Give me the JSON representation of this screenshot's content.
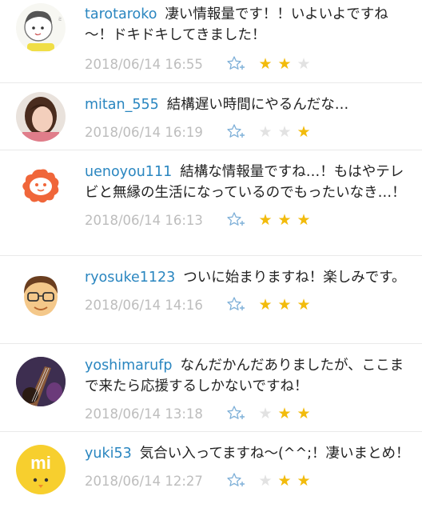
{
  "colors": {
    "username": "#2a86c0",
    "star_on": "#f2bb0c",
    "star_off": "#e2e2e2",
    "date": "#bdbdbd"
  },
  "comments": [
    {
      "user": "tarotaroko",
      "text": "凄い情報量です！！いよいよですね～！ドキドキしてきました！",
      "date": "2018/06/14 16:55",
      "avatar_icon": "cartoon-face-avatar",
      "rating": 2,
      "stars": [
        "on",
        "on",
        "off"
      ]
    },
    {
      "user": "mitan_555",
      "text": "結構遅い時間にやるんだな…",
      "date": "2018/06/14 16:19",
      "avatar_icon": "photo-woman-avatar",
      "rating": 1,
      "stars": [
        "off",
        "off",
        "on"
      ]
    },
    {
      "user": "uenoyou111",
      "text": "結構な情報量ですね…！もはやテレビと無縁の生活になっているのでもったいなき…！",
      "date": "2018/06/14 16:13",
      "avatar_icon": "orange-face-avatar",
      "rating": 3,
      "stars": [
        "on",
        "on",
        "on"
      ]
    },
    {
      "user": "ryosuke1123",
      "text": "ついに始まりますね！楽しみです。",
      "date": "2018/06/14 14:16",
      "avatar_icon": "glasses-man-avatar",
      "rating": 3,
      "stars": [
        "on",
        "on",
        "on"
      ]
    },
    {
      "user": "yoshimarufp",
      "text": "なんだかんだありましたが、ここまで来たら応援するしかないですね！",
      "date": "2018/06/14 13:18",
      "avatar_icon": "guitar-photo-avatar",
      "rating": 2,
      "stars": [
        "off",
        "on",
        "on"
      ]
    },
    {
      "user": "yuki53",
      "text": "気合い入ってますね～(^^;！凄いまとめ！",
      "date": "2018/06/14 12:27",
      "avatar_icon": "mi-logo-avatar",
      "rating": 2,
      "stars": [
        "off",
        "on",
        "on"
      ]
    }
  ]
}
